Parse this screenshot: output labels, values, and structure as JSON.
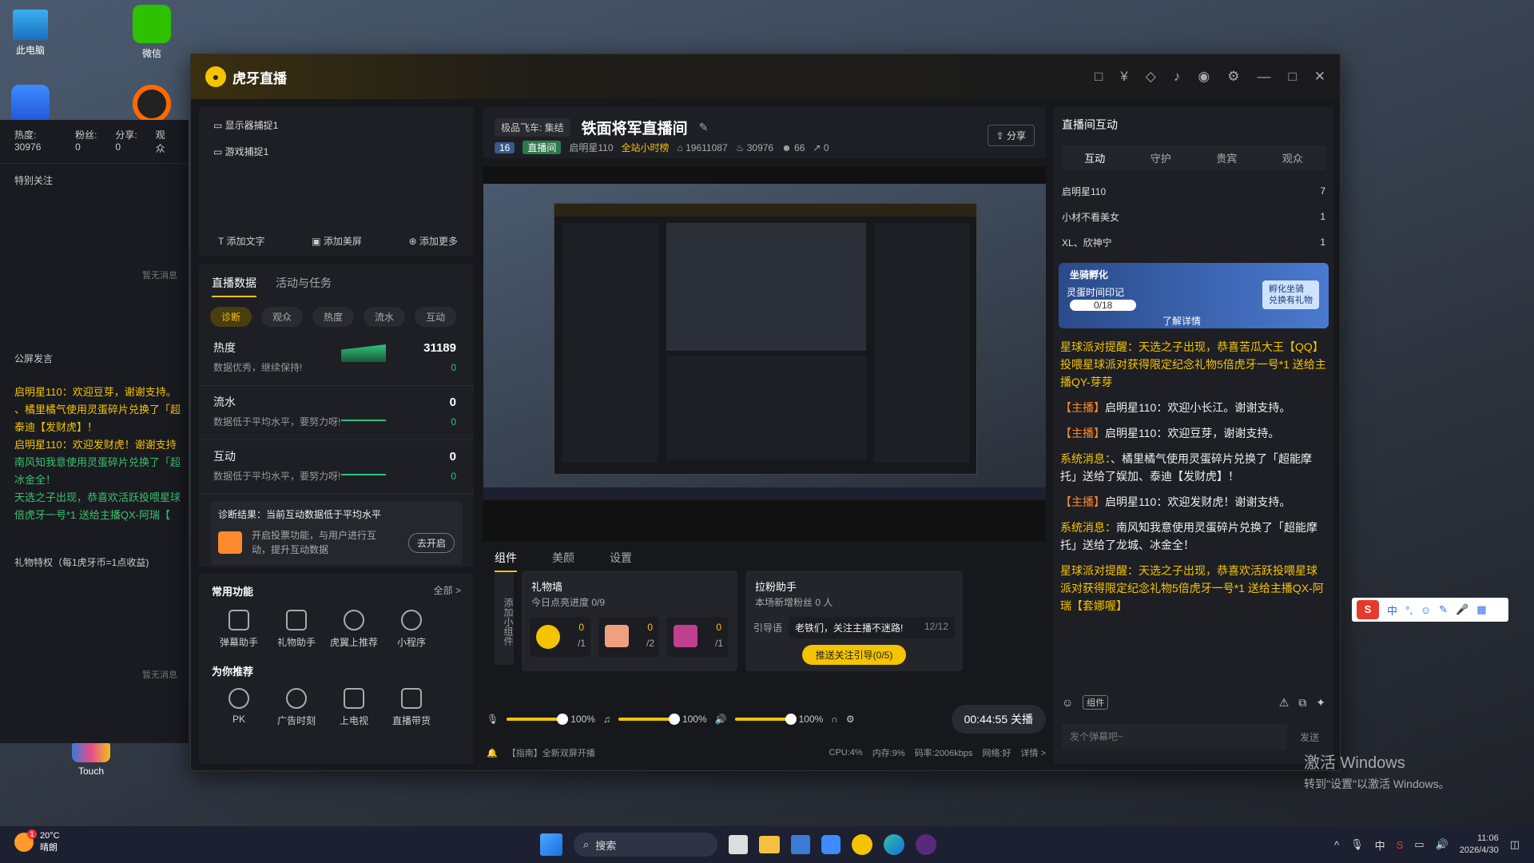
{
  "desktop": {
    "icons": [
      {
        "label": "此电脑"
      },
      {
        "label": "微信"
      },
      {
        "label": ""
      },
      {
        "label": ""
      },
      {
        "label": "Touch"
      }
    ],
    "watermark_title": "激活 Windows",
    "watermark_sub": "转到\"设置\"以激活 Windows。"
  },
  "bg_stats": {
    "hot": "热度: 30976",
    "fans": "粉丝: 0",
    "share": "分享: 0",
    "view": "观众"
  },
  "bg_left": {
    "special": "特别关注",
    "no_msg1": "暂无消息",
    "announce": "公屏发言",
    "no_msg2": "暂无消息",
    "gift_priv": "礼物特权（每1虎牙币=1点收益)",
    "lines": [
      "启明星110：欢迎豆芽，谢谢支持。",
      "、橘里橘气使用灵蛋碎片兑换了「超",
      "泰迪【发财虎】！",
      "启明星110：欢迎发财虎！谢谢支持",
      "南风知我意使用灵蛋碎片兑换了「超",
      "冰金全！",
      "天选之子出现，恭喜欢活跃投喂星球",
      "倍虎牙一号*1 送给主播QX-阿瑞【"
    ]
  },
  "app": {
    "title": "虎牙直播",
    "logo_glyph": "●",
    "title_icons": [
      "□",
      "¥",
      "◇",
      "♪",
      "◉",
      "⚙",
      "—",
      "□",
      "✕"
    ]
  },
  "sources": {
    "items": [
      "显示器捕捉1",
      "游戏捕捉1"
    ],
    "add_text": "添加文字",
    "add_beauty": "添加美屏",
    "add_more": "添加更多"
  },
  "data_panel": {
    "tabs": [
      "直播数据",
      "活动与任务"
    ],
    "pills": [
      "诊断",
      "观众",
      "热度",
      "流水",
      "互动"
    ],
    "metrics": [
      {
        "title": "热度",
        "sub": "数据优秀，继续保持!",
        "value": "31189",
        "delta": "0"
      },
      {
        "title": "流水",
        "sub": "数据低于平均水平，要努力呀!",
        "value": "0",
        "delta": "0"
      },
      {
        "title": "互动",
        "sub": "数据低于平均水平，要努力呀!",
        "value": "0",
        "delta": "0"
      }
    ],
    "diag_title": "诊断结果：当前互动数据低于平均水平",
    "diag_text1": "开启投票功能，与用户进行互",
    "diag_text2": "动，提升互动数据",
    "diag_btn": "去开启"
  },
  "functions": {
    "title": "常用功能",
    "all": "全部 >",
    "items": [
      "弹幕助手",
      "礼物助手",
      "虎翼上推荐",
      "小程序"
    ],
    "rec_title": "为你推荐",
    "rec_items": [
      "PK",
      "广告时刻",
      "上电视",
      "直播带货"
    ]
  },
  "stream": {
    "category": "极品飞车: 集结",
    "title": "铁面将军直播间",
    "share": "分享",
    "level": "16",
    "badge": "直播间",
    "host": "启明星110",
    "rank": "全站小时榜",
    "room": "19611087",
    "hot": "30976",
    "viewers": "66",
    "shares": "0"
  },
  "bottom_tabs": [
    "组件",
    "美颜",
    "设置"
  ],
  "gift_wall": {
    "title": "礼物墙",
    "progress": "今日点亮进度 0/9",
    "add_label": "添加小组件",
    "gifts": [
      {
        "count": "0",
        "total": "/1"
      },
      {
        "count": "0",
        "total": "/2"
      },
      {
        "count": "0",
        "total": "/1"
      }
    ]
  },
  "fan_helper": {
    "title": "拉粉助手",
    "sub": "本场新增粉丝 0 人",
    "guide_label": "引导语",
    "guide_text": "老铁们，关注主播不迷路!",
    "guide_count": "12/12",
    "push_btn": "推送关注引导(0/5)"
  },
  "controls": {
    "mic_vol": "100%",
    "music_vol": "100%",
    "speaker_vol": "100%",
    "mic_fill": 1.0,
    "music_fill": 1.0,
    "speaker_fill": 1.0,
    "timer": "00:44:55 关播"
  },
  "status": {
    "tip": "【指南】全新双屏开播",
    "cpu": "CPU:4%",
    "mem": "内存:9%",
    "bitrate": "码率:2006kbps",
    "net": "网络:好",
    "detail": "详情 >"
  },
  "interaction": {
    "title": "直播间互动",
    "tabs": [
      "互动",
      "守护",
      "贵宾",
      "观众"
    ],
    "rank": [
      {
        "name": "启明星110",
        "val": "7"
      },
      {
        "name": "小材不看美女",
        "val": "1"
      },
      {
        "name": "XL、欣神宁",
        "val": "1"
      }
    ],
    "banner_title": "坐骑孵化",
    "banner_sub": "灵蛋时间印记",
    "banner_progress": "0/18",
    "banner_btn": "孵化坐骑\n兑换有礼物",
    "banner_more": "了解详情",
    "msgs": [
      {
        "prefix": "星球派对提醒：",
        "text": "天选之子出现，恭喜苦瓜大王【QQ】投喂星球派对获得限定纪念礼物5倍虎牙一号*1 送给主播QY-芽芽",
        "type": "party"
      },
      {
        "prefix": "【主播】",
        "text": "启明星110：欢迎小长江。谢谢支持。",
        "type": "host"
      },
      {
        "prefix": "【主播】",
        "text": "启明星110：欢迎豆芽，谢谢支持。",
        "type": "host"
      },
      {
        "prefix": "系统消息：",
        "text": "、橘里橘气使用灵蛋碎片兑换了「超能摩托」送给了娱加、泰迪【发财虎】！",
        "type": "sys"
      },
      {
        "prefix": "【主播】",
        "text": "启明星110：欢迎发财虎！谢谢支持。",
        "type": "host"
      },
      {
        "prefix": "系统消息：",
        "text": "南风知我意使用灵蛋碎片兑换了「超能摩托」送给了龙城、冰金全！",
        "type": "sys"
      },
      {
        "prefix": "星球派对提醒：",
        "text": "天选之子出现，恭喜欢活跃投喂星球派对获得限定纪念礼物5倍虎牙一号*1 送给主播QX-阿瑞【套娜喔】",
        "type": "party"
      }
    ],
    "input_placeholder": "发个弹幕吧~",
    "send": "发送",
    "tool_label": "组件"
  },
  "ime": {
    "items": [
      "中",
      "°,",
      "☺",
      "✎",
      "🎤",
      "▦"
    ]
  },
  "taskbar": {
    "weather_temp": "20°C",
    "weather_desc": "晴朗",
    "weather_badge": "1",
    "search": "搜索",
    "time": "11:06",
    "date": "2026/4/30"
  }
}
